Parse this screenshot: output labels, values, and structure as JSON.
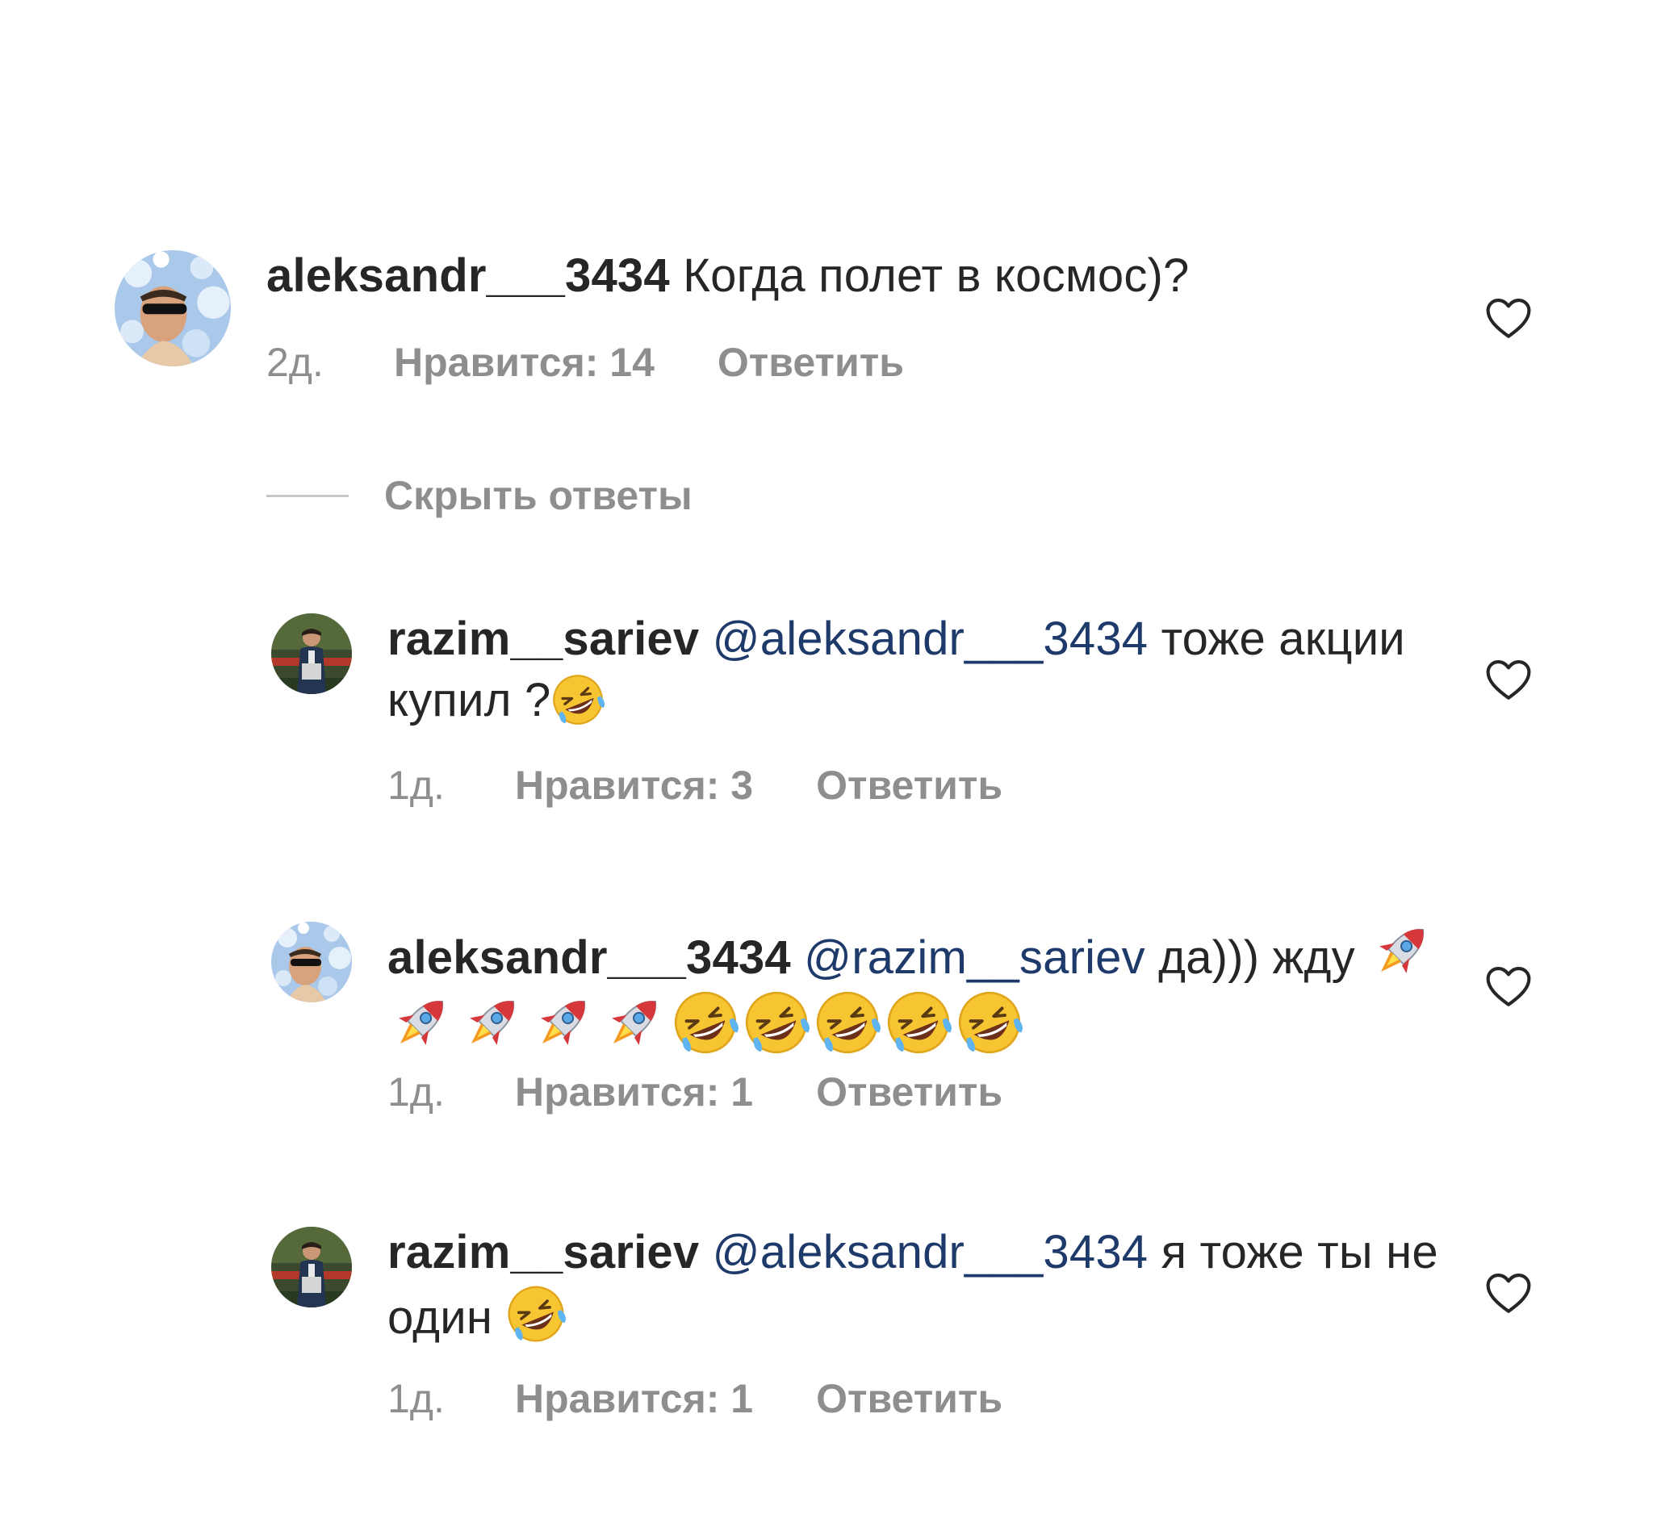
{
  "comments": [
    {
      "username": "aleksandr___3434",
      "mention": "",
      "text": "Когда полет в космос)?",
      "time": "2д.",
      "likes": "Нравится: 14",
      "reply": "Ответить"
    },
    {
      "username": "razim__sariev",
      "mention": "@aleksandr___3434",
      "text": "тоже акции купил ?",
      "emoji_tail": [
        "rolling-on-floor-laughing"
      ],
      "time": "1д.",
      "likes": "Нравится: 3",
      "reply": "Ответить"
    },
    {
      "username": "aleksandr___3434",
      "mention": "@razim__sariev",
      "text": "да))) жду",
      "emoji_tail": [
        "rocket",
        "rocket",
        "rocket",
        "rocket",
        "rocket",
        "rolling-on-floor-laughing",
        "rolling-on-floor-laughing",
        "rolling-on-floor-laughing",
        "rolling-on-floor-laughing",
        "rolling-on-floor-laughing"
      ],
      "time": "1д.",
      "likes": "Нравится: 1",
      "reply": "Ответить"
    },
    {
      "username": "razim__sariev",
      "mention": "@aleksandr___3434",
      "text": "я тоже ты не один",
      "emoji_tail": [
        "rolling-on-floor-laughing"
      ],
      "time": "1д.",
      "likes": "Нравится: 1",
      "reply": "Ответить"
    }
  ],
  "hide_replies_label": "Скрыть ответы",
  "colors": {
    "text": "#262626",
    "meta": "#8e8e8e",
    "mention": "#1d3a6b",
    "divider": "#c7c7c7"
  },
  "icons": {
    "like": "heart-outline-icon",
    "laugh": "rolling-on-floor-laughing-emoji",
    "rocket": "rocket-emoji"
  }
}
